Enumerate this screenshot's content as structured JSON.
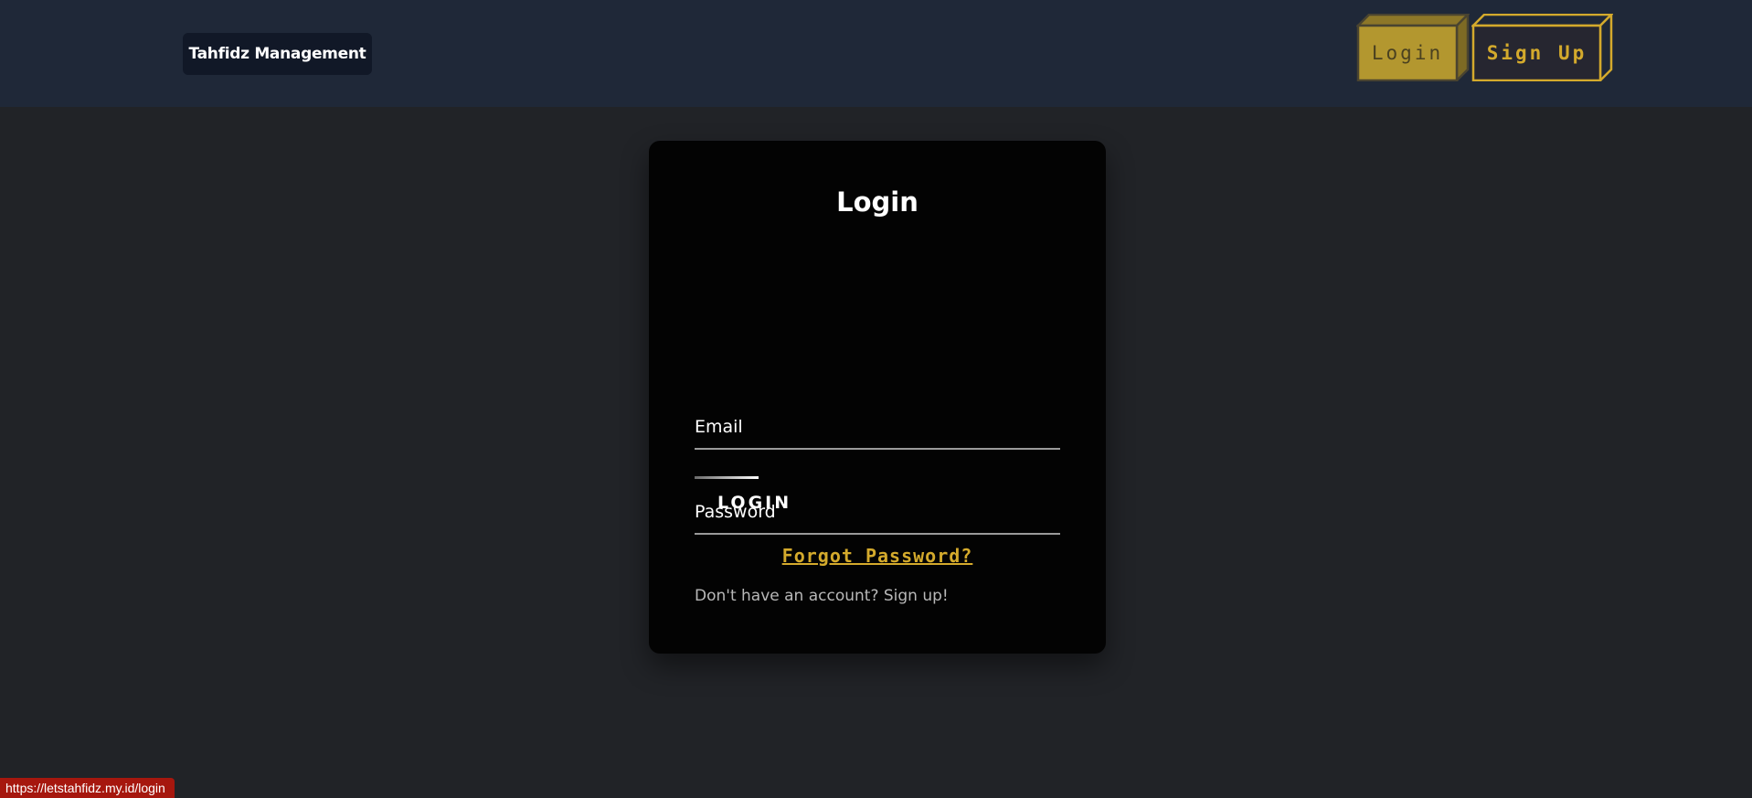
{
  "header": {
    "brand": "Tahfidz Management",
    "nav": {
      "login_label": "Login",
      "signup_label": "Sign Up"
    }
  },
  "login_card": {
    "title": "Login",
    "email_placeholder": "Email",
    "password_placeholder": "Password",
    "submit_label": "LOGIN",
    "forgot_password": "Forgot Password?",
    "signup_prompt": "Don't have an account? Sign up!"
  },
  "status_bar": {
    "url": "https://letstahfidz.my.id/login"
  },
  "colors": {
    "page_background": "#212327",
    "header_background": "#1f2838",
    "card_background": "#030303",
    "accent_gold": "#d4aa2c",
    "login_button_fill": "#b3972f",
    "status_bar": "#a6170e"
  }
}
